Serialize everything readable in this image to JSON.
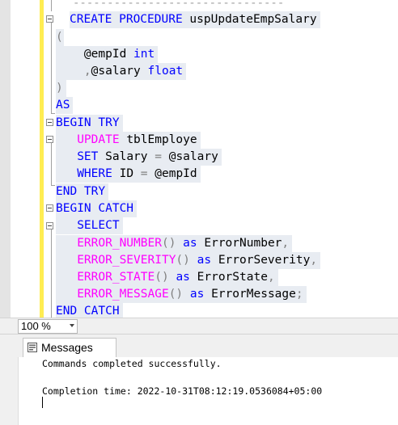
{
  "editor": {
    "top_dashes": "-------------------------------",
    "lines": {
      "create": {
        "kw": "CREATE PROCEDURE",
        "name": " uspUpdateEmpSalary"
      },
      "open_paren": "(",
      "param1": {
        "name": "@empId",
        "type": "int"
      },
      "param2": {
        "comma": ",",
        "name": "@salary",
        "type": "float"
      },
      "close_paren": ")",
      "as": "AS",
      "begin_try": "BEGIN TRY",
      "update": {
        "kw": "UPDATE",
        "table": " tblEmploye"
      },
      "set": {
        "kw": "SET",
        "col": " Salary",
        "eq": " =",
        "val": " @salary"
      },
      "where": {
        "kw": "WHERE",
        "col": " ID",
        "eq": " =",
        "val": " @empId"
      },
      "end_try": "END TRY",
      "begin_catch": "BEGIN CATCH",
      "select": "SELECT",
      "f1": {
        "fn": "ERROR_NUMBER",
        "rest": "() ",
        "as": "as",
        "alias": " ErrorNumber",
        "end": ","
      },
      "f2": {
        "fn": "ERROR_SEVERITY",
        "rest": "() ",
        "as": "as",
        "alias": " ErrorSeverity",
        "end": ","
      },
      "f3": {
        "fn": "ERROR_STATE",
        "rest": "() ",
        "as": "as",
        "alias": " ErrorState",
        "end": ","
      },
      "f4": {
        "fn": "ERROR_MESSAGE",
        "rest": "() ",
        "as": "as",
        "alias": " ErrorMessage",
        "end": ";"
      },
      "end_catch": "END CATCH"
    }
  },
  "zoom": {
    "value": "100 %"
  },
  "results": {
    "tab_label": "Messages",
    "line1": "Commands completed successfully.",
    "line2": "Completion time: 2022-10-31T08:12:19.0536084+05:00"
  },
  "colors": {
    "keyword": "#0000ff",
    "function": "#ff00ff",
    "operator": "#808080",
    "margin": "#ffed52"
  }
}
